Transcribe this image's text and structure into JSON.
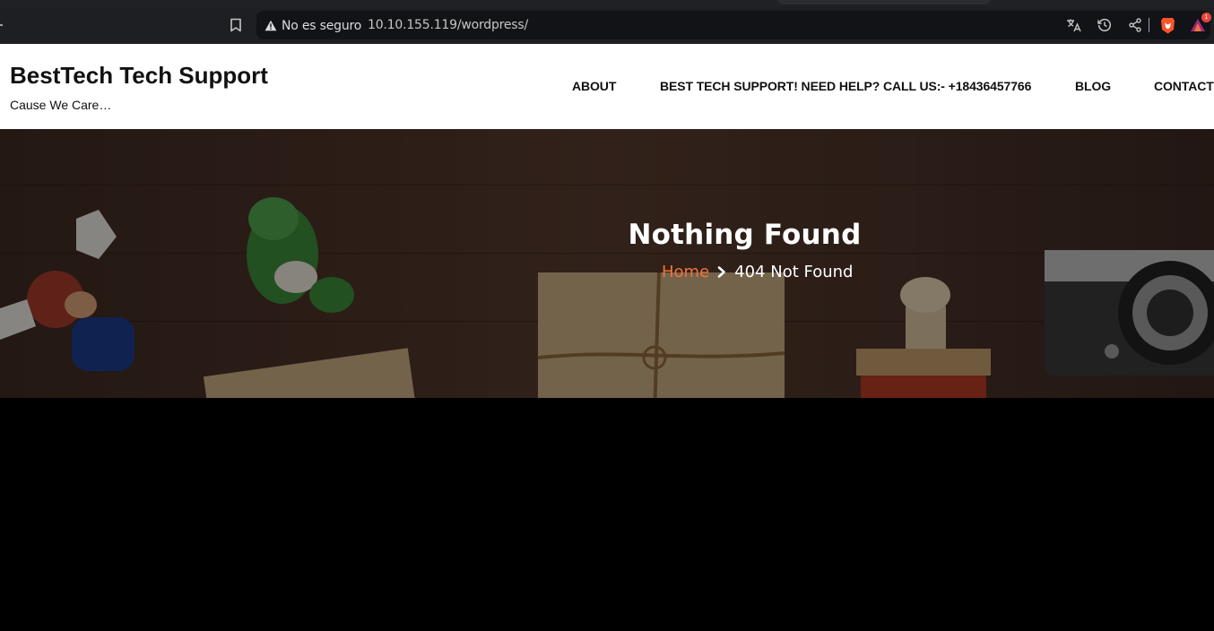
{
  "browser": {
    "security_label": "No es seguro",
    "url": "10.10.155.119/wordpress/",
    "notification_count": "1",
    "icons": [
      "bookmark-icon",
      "warning-icon",
      "translate-icon",
      "history-icon",
      "share-icon",
      "brave-shields-icon",
      "brave-rewards-icon"
    ]
  },
  "site": {
    "title": "BestTech Tech Support",
    "tagline": "Cause We Care…",
    "nav": [
      {
        "label": "ABOUT"
      },
      {
        "label": "BEST TECH SUPPORT! NEED HELP? CALL US:- +18436457766"
      },
      {
        "label": "BLOG"
      },
      {
        "label": "CONTACT"
      }
    ]
  },
  "hero": {
    "title": "Nothing Found",
    "breadcrumb": {
      "home": "Home",
      "current": "404 Not Found"
    }
  },
  "colors": {
    "accent": "#f0743c",
    "header_bg": "#ffffff",
    "page_bg": "#000000",
    "browser_toolbar": "#1e1f22"
  }
}
